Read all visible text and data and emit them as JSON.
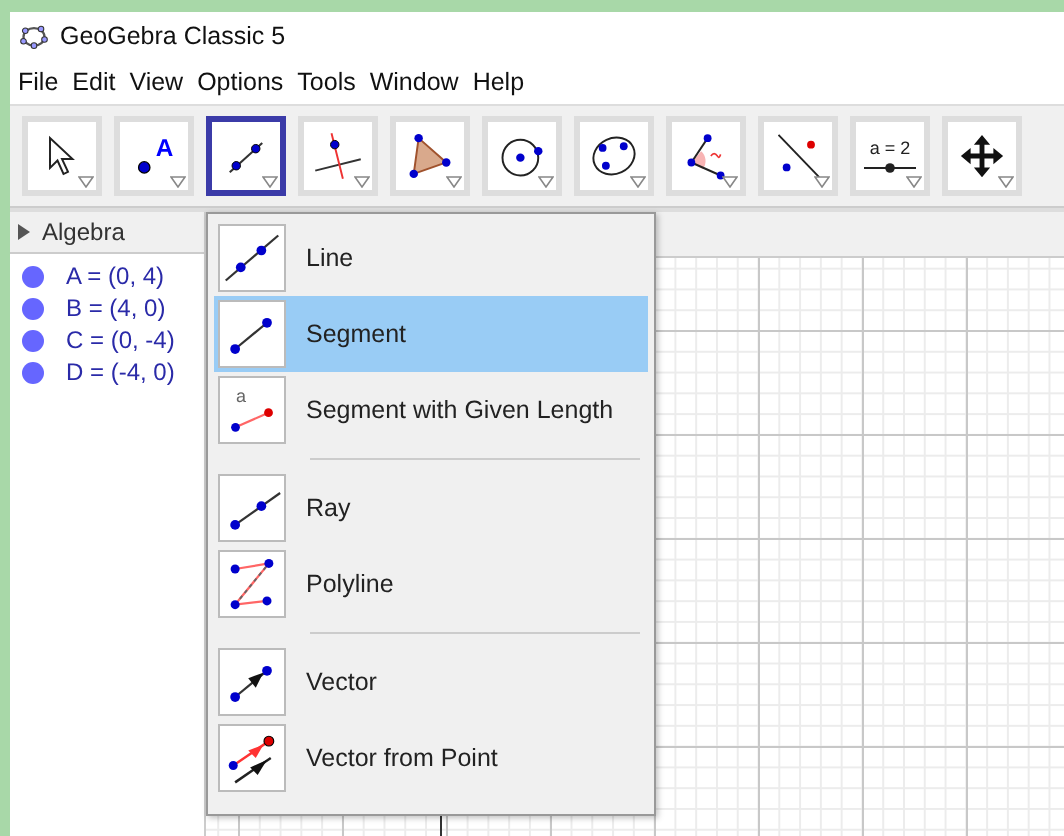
{
  "window": {
    "title": "GeoGebra Classic 5"
  },
  "menu": [
    "File",
    "Edit",
    "View",
    "Options",
    "Tools",
    "Window",
    "Help"
  ],
  "toolbar": [
    {
      "kind": "move",
      "selected": false
    },
    {
      "kind": "point",
      "label": "A",
      "selected": false
    },
    {
      "kind": "segment",
      "selected": true
    },
    {
      "kind": "perpendicular",
      "selected": false
    },
    {
      "kind": "polygon",
      "selected": false
    },
    {
      "kind": "circle",
      "selected": false
    },
    {
      "kind": "conic",
      "selected": false
    },
    {
      "kind": "angle",
      "selected": false
    },
    {
      "kind": "reflect",
      "selected": false
    },
    {
      "kind": "slider",
      "label": "a = 2",
      "selected": false
    },
    {
      "kind": "move-view",
      "selected": false
    }
  ],
  "algebra": {
    "title": "Algebra",
    "objects": [
      {
        "text": "A = (0, 4)",
        "color": "#6666ff"
      },
      {
        "text": "B = (4, 0)",
        "color": "#6666ff"
      },
      {
        "text": "C = (0, -4)",
        "color": "#6666ff"
      },
      {
        "text": "D = (-4, 0)",
        "color": "#6666ff"
      }
    ]
  },
  "dropdown": {
    "groups": [
      [
        {
          "kind": "line",
          "label": "Line",
          "selected": false
        },
        {
          "kind": "segment",
          "label": "Segment",
          "selected": true
        },
        {
          "kind": "segment-length",
          "label": "Segment with Given Length",
          "icon_text": "a",
          "selected": false
        }
      ],
      [
        {
          "kind": "ray",
          "label": "Ray",
          "selected": false
        },
        {
          "kind": "polyline",
          "label": "Polyline",
          "selected": false
        }
      ],
      [
        {
          "kind": "vector",
          "label": "Vector",
          "selected": false
        },
        {
          "kind": "vector-from-point",
          "label": "Vector from Point",
          "selected": false
        }
      ]
    ]
  }
}
